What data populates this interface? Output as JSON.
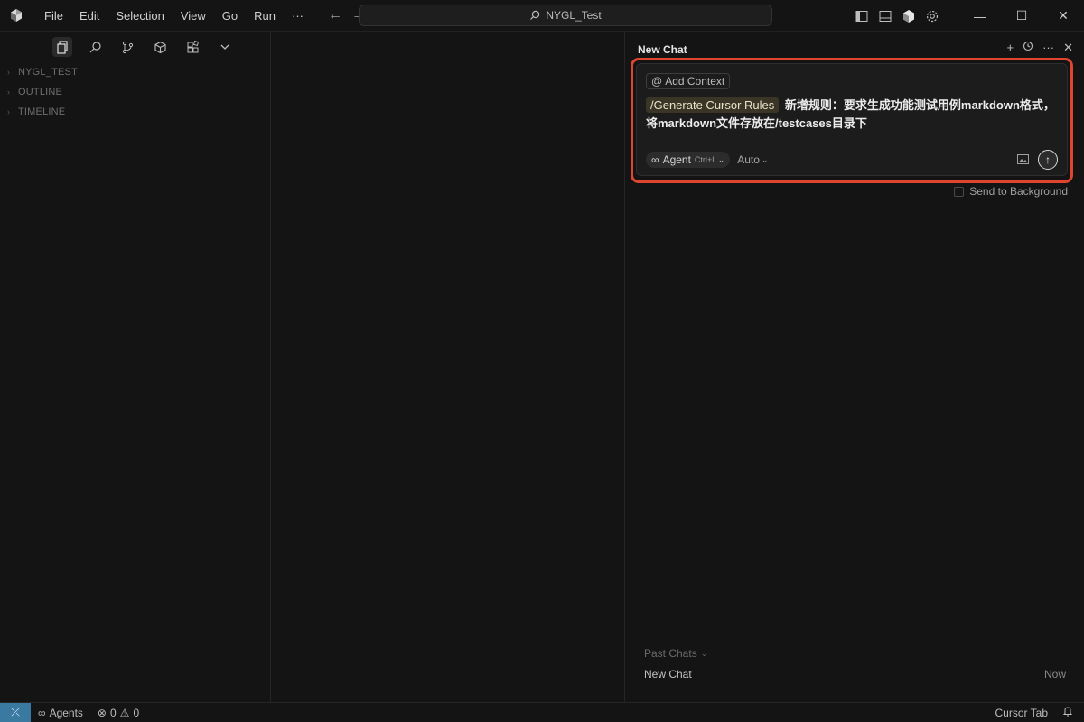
{
  "titlebar": {
    "menu": [
      "File",
      "Edit",
      "Selection",
      "View",
      "Go",
      "Run",
      "···"
    ],
    "workspace": "NYGL_Test"
  },
  "sidebar": {
    "sections": [
      "NYGL_TEST",
      "OUTLINE",
      "TIMELINE"
    ]
  },
  "chat": {
    "title": "New Chat",
    "add_context": "Add Context",
    "slash_command": "/Generate Cursor Rules",
    "message": "新增规则：要求生成功能测试用例markdown格式，将markdown文件存放在/testcases目录下",
    "agent_label": "Agent",
    "agent_shortcut": "Ctrl+I",
    "model": "Auto",
    "send_to_background": "Send to Background",
    "past_chats_label": "Past Chats",
    "history": [
      {
        "name": "New Chat",
        "time": "Now"
      }
    ]
  },
  "statusbar": {
    "agents": "Agents",
    "errors": "0",
    "warnings": "0",
    "cursor_tab": "Cursor Tab"
  },
  "colors": {
    "highlight_outline": "#e0452f",
    "remote_indicator": "#3a7aa0"
  }
}
